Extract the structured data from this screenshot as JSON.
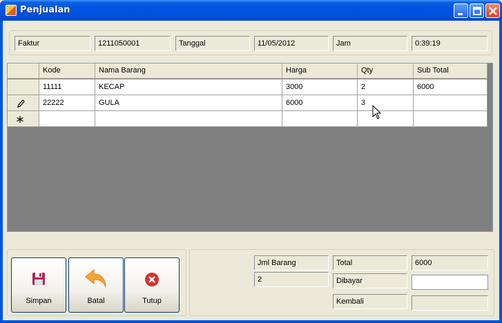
{
  "window": {
    "title": "Penjualan"
  },
  "info": {
    "faktur_label": "Faktur",
    "faktur_value": "1211050001",
    "tanggal_label": "Tanggal",
    "tanggal_value": "11/05/2012",
    "jam_label": "Jam",
    "jam_value": "0:39:19"
  },
  "grid": {
    "columns": [
      "Kode",
      "Nama Barang",
      "Harga",
      "Qty",
      "Sub Total"
    ],
    "rows": [
      {
        "kode": "11111",
        "nama": "KECAP",
        "harga": "3000",
        "qty": "2",
        "subtotal": "6000"
      },
      {
        "kode": "22222",
        "nama": "GULA",
        "harga": "6000",
        "qty": "3",
        "subtotal": ""
      }
    ],
    "row_markers": [
      "",
      "pencil-icon",
      "asterisk-icon"
    ]
  },
  "buttons": {
    "simpan": "Simpan",
    "batal": "Batal",
    "tutup": "Tutup"
  },
  "summary": {
    "jml_barang_label": "Jml Barang",
    "jml_barang_value": "2",
    "total_label": "Total",
    "total_value": "6000",
    "dibayar_label": "Dibayar",
    "dibayar_value": "",
    "kembali_label": "Kembali",
    "kembali_value": ""
  },
  "colors": {
    "titlebar": "#0054e3",
    "window_bg": "#ece9d8",
    "grid_bg": "#808080"
  }
}
